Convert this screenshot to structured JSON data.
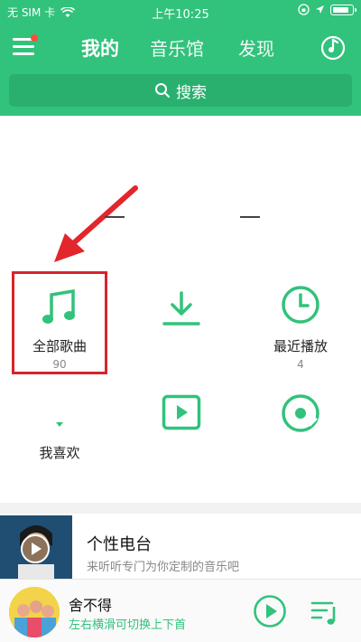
{
  "status_bar": {
    "carrier": "无 SIM 卡",
    "time": "上午10:25"
  },
  "nav": {
    "tabs": [
      {
        "label": "我的",
        "active": true
      },
      {
        "label": "音乐馆",
        "active": false
      },
      {
        "label": "发现",
        "active": false
      }
    ]
  },
  "search": {
    "placeholder": "搜索"
  },
  "grid": {
    "all_songs": {
      "label": "全部歌曲",
      "count": "90"
    },
    "recent": {
      "label": "最近播放",
      "count": "4"
    },
    "favorites": {
      "label": "我喜欢"
    }
  },
  "radio": {
    "title": "个性电台",
    "subtitle": "来听听专门为你定制的音乐吧"
  },
  "player": {
    "song": "舍不得",
    "hint": "左右横滑可切换上下首"
  },
  "colors": {
    "brand_green": "#31c27c",
    "highlight_red": "#d9232b"
  }
}
